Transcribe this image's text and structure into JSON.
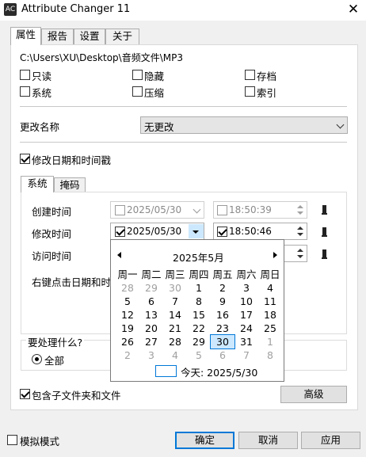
{
  "window": {
    "title": "Attribute Changer 11",
    "icon_text": "AC"
  },
  "tabs": [
    "属性",
    "报告",
    "设置",
    "关于"
  ],
  "path": "C:\\Users\\XU\\Desktop\\音频文件\\MP3",
  "attributes": {
    "readonly": "只读",
    "hidden": "隐藏",
    "archive": "存档",
    "system": "系统",
    "compressed": "压缩",
    "indexed": "索引"
  },
  "rename": {
    "label": "更改名称",
    "value": "无更改"
  },
  "modify_datetime": {
    "label": "修改日期和时间戳",
    "checked": true
  },
  "subtabs": [
    "系统",
    "掩码"
  ],
  "times": {
    "created": {
      "label": "创建时间",
      "date": "2025/05/30",
      "time": "18:50:39",
      "checked": false
    },
    "modified": {
      "label": "修改时间",
      "date": "2025/05/30",
      "time": "18:50:46",
      "checked": true
    },
    "accessed": {
      "label": "访问时间"
    }
  },
  "right_click_hint": "右键点击日期和时间",
  "calendar": {
    "month_title": "2025年5月",
    "weekdays": [
      "周一",
      "周二",
      "周三",
      "周四",
      "周五",
      "周六",
      "周日"
    ],
    "weeks": [
      [
        "28",
        "29",
        "30",
        "1",
        "2",
        "3",
        "4"
      ],
      [
        "5",
        "6",
        "7",
        "8",
        "9",
        "10",
        "11"
      ],
      [
        "12",
        "13",
        "14",
        "15",
        "16",
        "17",
        "18"
      ],
      [
        "19",
        "20",
        "21",
        "22",
        "23",
        "24",
        "25"
      ],
      [
        "26",
        "27",
        "28",
        "29",
        "30",
        "31",
        "1"
      ],
      [
        "2",
        "3",
        "4",
        "5",
        "6",
        "7",
        "8"
      ]
    ],
    "today_label": "今天: 2025/5/30"
  },
  "process": {
    "label": "要处理什么?",
    "option": "全部"
  },
  "include_sub": {
    "label": "包含子文件夹和文件",
    "checked": true
  },
  "buttons": {
    "advanced": "高级",
    "ok": "确定",
    "cancel": "取消",
    "apply": "应用"
  },
  "simulate": {
    "label": "模拟模式",
    "checked": false
  }
}
